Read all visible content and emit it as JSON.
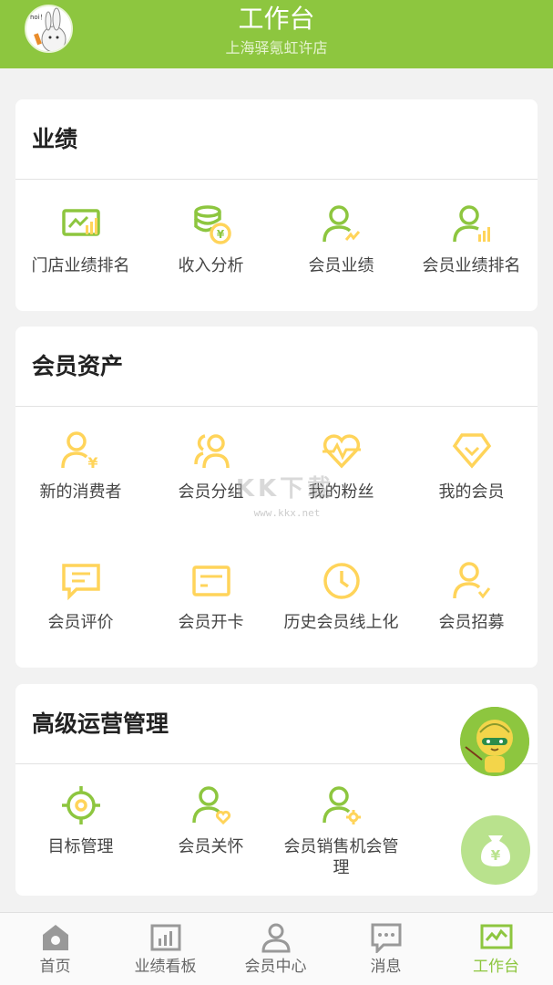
{
  "header": {
    "title": "工作台",
    "subtitle": "上海驿氪虹许店",
    "avatar_text": "hoi！"
  },
  "colors": {
    "brand": "#8dc63f",
    "icon_green": "#8dc63f",
    "icon_yellow": "#ffd45a",
    "tab_inactive": "#999999"
  },
  "sections": [
    {
      "title": "业绩",
      "items": [
        {
          "label": "门店业绩排名",
          "icon": "store-rank-chart-icon"
        },
        {
          "label": "收入分析",
          "icon": "coins-yen-icon"
        },
        {
          "label": "会员业绩",
          "icon": "member-trend-icon"
        },
        {
          "label": "会员业绩排名",
          "icon": "member-bars-icon"
        }
      ]
    },
    {
      "title": "会员资产",
      "items": [
        {
          "label": "新的消费者",
          "icon": "person-yen-icon"
        },
        {
          "label": "会员分组",
          "icon": "people-group-icon"
        },
        {
          "label": "我的粉丝",
          "icon": "heart-pulse-icon"
        },
        {
          "label": "我的会员",
          "icon": "diamond-icon"
        },
        {
          "label": "会员评价",
          "icon": "comment-bubble-icon"
        },
        {
          "label": "会员开卡",
          "icon": "card-icon"
        },
        {
          "label": "历史会员线上化",
          "icon": "clock-icon"
        },
        {
          "label": "会员招募",
          "icon": "person-check-icon"
        }
      ]
    },
    {
      "title": "高级运营管理",
      "items": [
        {
          "label": "目标管理",
          "icon": "target-icon"
        },
        {
          "label": "会员关怀",
          "icon": "person-heart-icon"
        },
        {
          "label": "会员销售机会管理",
          "icon": "person-gear-icon"
        }
      ]
    }
  ],
  "watermark": {
    "text": "KK下载",
    "url": "www.kkx.net"
  },
  "float_buttons": {
    "money_symbol": "¥"
  },
  "tabbar": [
    {
      "label": "首页",
      "icon": "home-icon",
      "active": false
    },
    {
      "label": "业绩看板",
      "icon": "dashboard-chart-icon",
      "active": false
    },
    {
      "label": "会员中心",
      "icon": "person-icon",
      "active": false
    },
    {
      "label": "消息",
      "icon": "message-icon",
      "active": false
    },
    {
      "label": "工作台",
      "icon": "workbench-icon",
      "active": true
    }
  ]
}
